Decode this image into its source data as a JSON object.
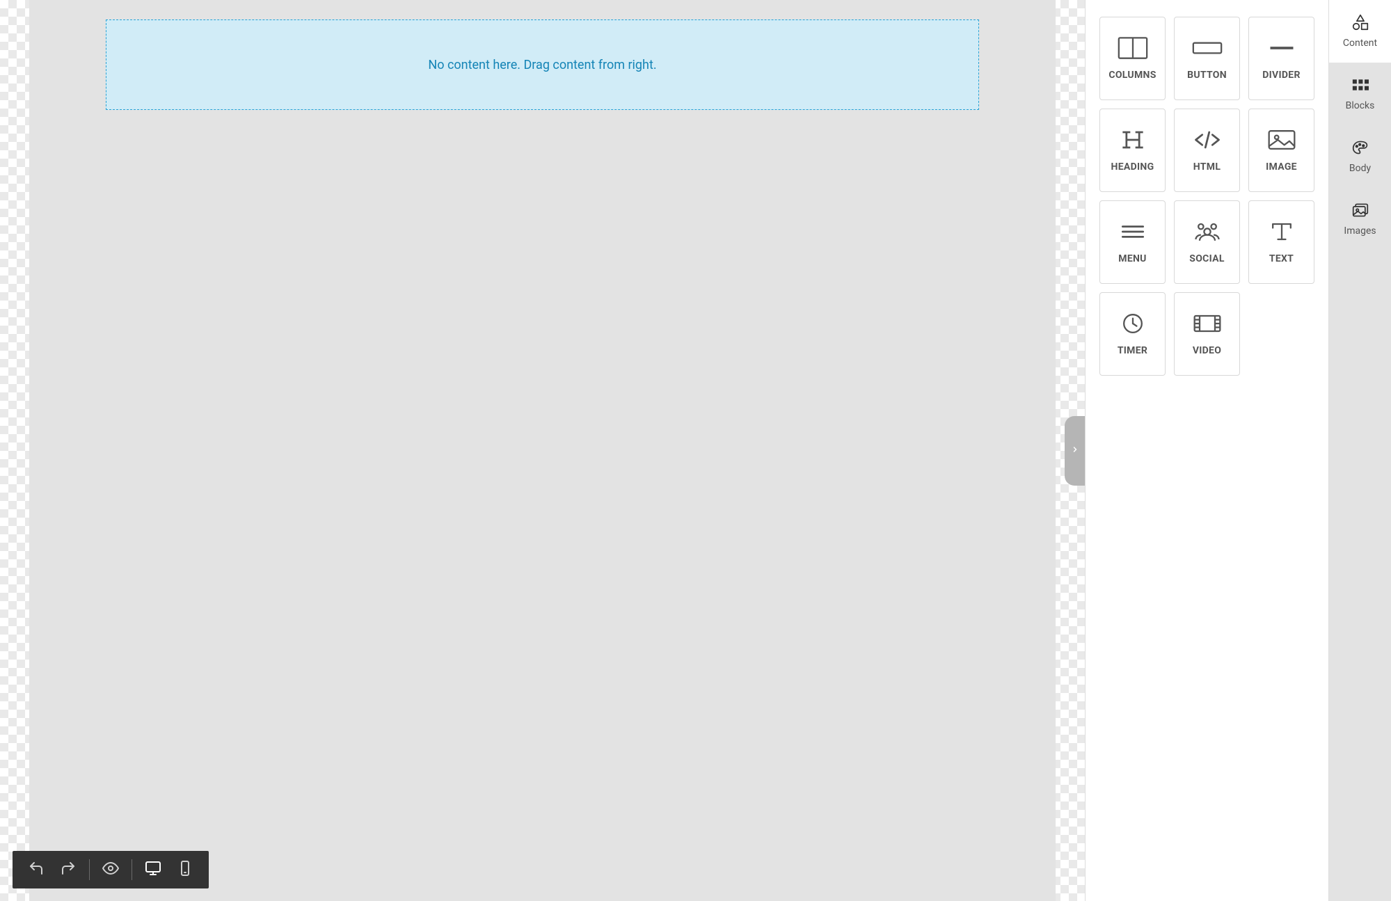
{
  "canvas": {
    "drop_hint": "No content here. Drag content from right."
  },
  "content_tiles": [
    {
      "id": "columns",
      "label": "COLUMNS"
    },
    {
      "id": "button",
      "label": "BUTTON"
    },
    {
      "id": "divider",
      "label": "DIVIDER"
    },
    {
      "id": "heading",
      "label": "HEADING"
    },
    {
      "id": "html",
      "label": "HTML"
    },
    {
      "id": "image",
      "label": "IMAGE"
    },
    {
      "id": "menu",
      "label": "MENU"
    },
    {
      "id": "social",
      "label": "SOCIAL"
    },
    {
      "id": "text",
      "label": "TEXT"
    },
    {
      "id": "timer",
      "label": "TIMER"
    },
    {
      "id": "video",
      "label": "VIDEO"
    }
  ],
  "side_tabs": [
    {
      "id": "content",
      "label": "Content",
      "active": true
    },
    {
      "id": "blocks",
      "label": "Blocks",
      "active": false
    },
    {
      "id": "body",
      "label": "Body",
      "active": false
    },
    {
      "id": "images",
      "label": "Images",
      "active": false
    }
  ],
  "bottom_toolbar": {
    "undo": "Undo",
    "redo": "Redo",
    "preview": "Preview",
    "desktop": "Desktop view",
    "mobile": "Mobile view"
  }
}
